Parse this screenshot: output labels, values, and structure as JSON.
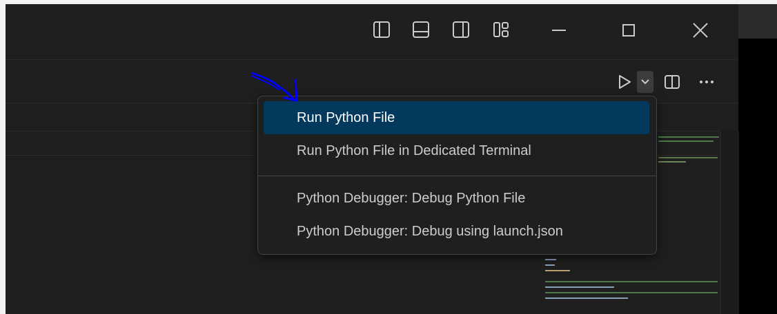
{
  "titlebar": {
    "icons": [
      "toggle-primary-sidebar-icon",
      "toggle-panel-icon",
      "toggle-secondary-sidebar-icon",
      "customize-layout-icon"
    ],
    "window_controls": [
      "minimize-icon",
      "maximize-icon",
      "close-icon"
    ]
  },
  "editor_toolbar": {
    "icons": [
      "run-icon",
      "chevron-down-icon",
      "split-editor-icon",
      "more-actions-icon"
    ]
  },
  "run_menu": {
    "items": [
      {
        "label": "Run Python File",
        "selected": true
      },
      {
        "label": "Run Python File in Dedicated Terminal",
        "selected": false
      },
      {
        "label": "Python Debugger: Debug Python File",
        "selected": false
      },
      {
        "label": "Python Debugger: Debug using launch.json",
        "selected": false
      }
    ]
  },
  "colors": {
    "selection": "#04395e",
    "annotation_arrow": "#0000ff",
    "background": "#1f1f1f"
  }
}
